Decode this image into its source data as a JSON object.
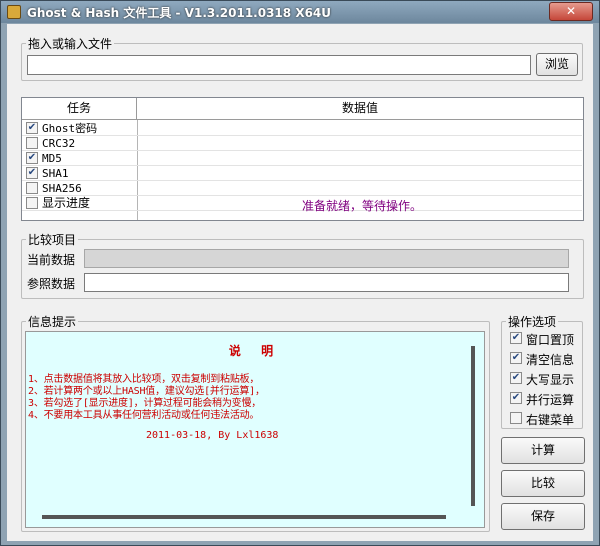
{
  "window": {
    "title": "Ghost & Hash 文件工具 - V1.3.2011.0318 X64U",
    "close_glyph": "✕"
  },
  "file": {
    "group_label": "拖入或输入文件",
    "value": "",
    "browse_label": "浏览"
  },
  "tasks": {
    "header_task": "任务",
    "header_value": "数据值",
    "items": [
      {
        "label": "Ghost密码",
        "checked": true
      },
      {
        "label": "CRC32",
        "checked": false
      },
      {
        "label": "MD5",
        "checked": true
      },
      {
        "label": "SHA1",
        "checked": true
      },
      {
        "label": "SHA256",
        "checked": false
      },
      {
        "label": "显示进度",
        "checked": false
      }
    ],
    "status": "准备就绪，等待操作。",
    "status_color": "#800080"
  },
  "compare": {
    "group_label": "比较项目",
    "current_label": "当前数据",
    "reference_label": "参照数据"
  },
  "info": {
    "group_label": "信息提示",
    "title": "说 明",
    "lines": [
      "1、点击数据值将其放入比较项，双击复制到粘贴板，",
      "2、若计算两个或以上HASH值，建议勾选[并行运算]，",
      "3、若勾选了[显示进度]，计算过程可能会稍为变慢，",
      "4、不要用本工具从事任何营利活动或任何违法活动。"
    ],
    "signature": "2011-03-18, By Lxl1638",
    "text_color": "#cc0000",
    "background": "#e0ffff"
  },
  "options": {
    "group_label": "操作选项",
    "items": [
      {
        "label": "窗口置顶",
        "checked": true
      },
      {
        "label": "清空信息",
        "checked": true
      },
      {
        "label": "大写显示",
        "checked": true
      },
      {
        "label": "并行运算",
        "checked": true
      },
      {
        "label": "右键菜单",
        "checked": false
      }
    ]
  },
  "actions": {
    "compute_label": "计算",
    "compare_label": "比较",
    "save_label": "保存"
  }
}
